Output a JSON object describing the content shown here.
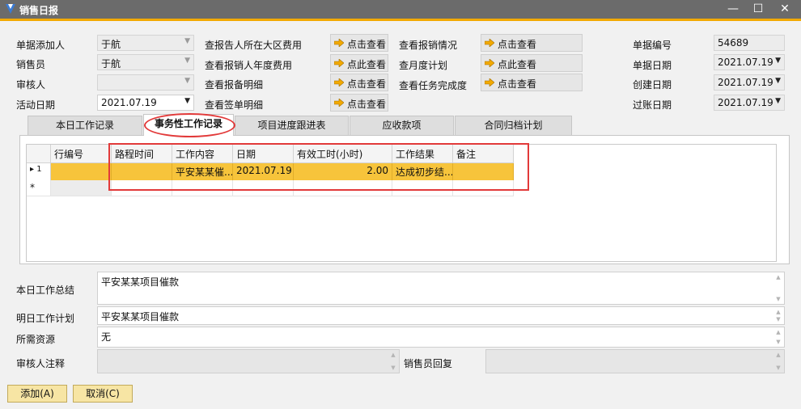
{
  "window": {
    "title": "销售日报",
    "minimize": "—",
    "maximize": "☐",
    "close": "✕"
  },
  "header_left": [
    {
      "label": "单据添加人",
      "value": "于航"
    },
    {
      "label": "销售员",
      "value": "于航"
    },
    {
      "label": "审核人",
      "value": ""
    },
    {
      "label": "活动日期",
      "value": "2021.07.19"
    }
  ],
  "view_links": [
    {
      "label": "查报告人所在大区费用",
      "button": "点击查看"
    },
    {
      "label": "查看报销人年度费用",
      "button": "点此查看"
    },
    {
      "label": "查看报备明细",
      "button": "点击查看"
    },
    {
      "label": "查看签单明细",
      "button": "点击查看"
    }
  ],
  "view_links_2": [
    {
      "label": "查看报销情况",
      "button": "点击查看"
    },
    {
      "label": "查月度计划",
      "button": "点此查看"
    },
    {
      "label": "查看任务完成度",
      "button": "点击查看"
    }
  ],
  "header_right": [
    {
      "label": "单据编号",
      "value": "54689"
    },
    {
      "label": "单据日期",
      "value": "2021.07.19"
    },
    {
      "label": "创建日期",
      "value": "2021.07.19"
    },
    {
      "label": "过账日期",
      "value": "2021.07.19"
    }
  ],
  "tabs": [
    "本日工作记录",
    "事务性工作记录",
    "项目进度跟进表",
    "应收款项",
    "合同归档计划"
  ],
  "grid": {
    "columns": [
      "行编号",
      "路程时间",
      "工作内容",
      "日期",
      "有效工时(小时)",
      "工作结果",
      "备注"
    ],
    "row": {
      "indicator": "▸",
      "no": "1",
      "travel": "",
      "content": "平安某某催...",
      "date": "2021.07.19",
      "hours": "2.00",
      "result": "达成初步结...",
      "note": ""
    },
    "new_row_marker": "*"
  },
  "summary": {
    "today_label": "本日工作总结",
    "today_value": "平安某某项目催款",
    "tomorrow_label": "明日工作计划",
    "tomorrow_value": "平安某某项目催款",
    "resources_label": "所需资源",
    "resources_value": "无",
    "reviewer_note_label": "审核人注释",
    "reviewer_note_value": "",
    "sales_reply_label": "销售员回复",
    "sales_reply_value": ""
  },
  "buttons": {
    "add": "添加(A)",
    "cancel": "取消(C)"
  },
  "colors": {
    "accent": "#f2a900",
    "selected_row": "#f7c43b",
    "highlight": "#e23a3a",
    "titlebar": "#6b6b6b"
  }
}
